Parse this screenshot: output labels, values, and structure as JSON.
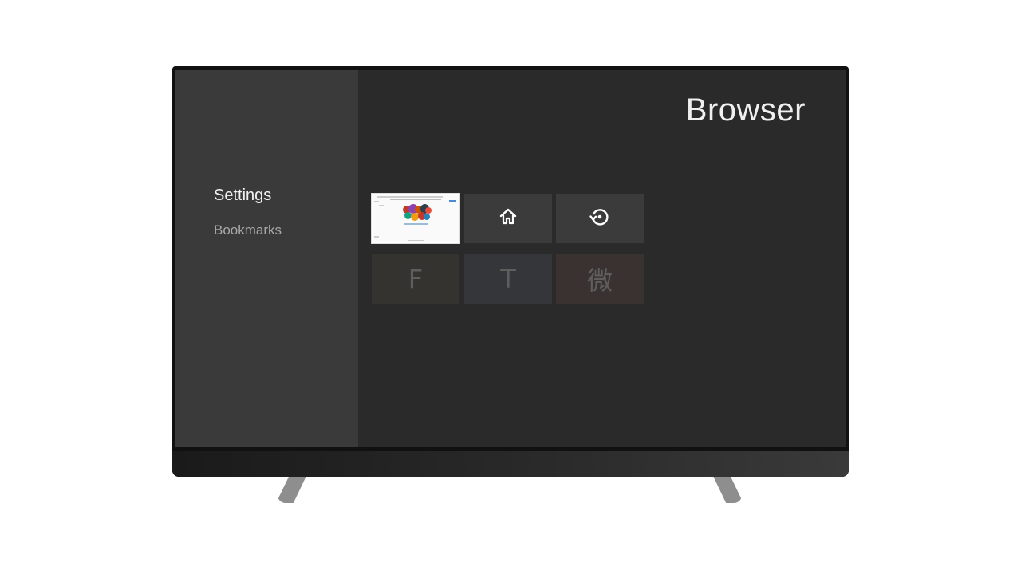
{
  "app": {
    "title": "Browser"
  },
  "sidebar": {
    "items": [
      {
        "label": "Settings",
        "active": true
      },
      {
        "label": "Bookmarks",
        "active": false
      }
    ]
  },
  "tiles": {
    "thumbnail": {
      "kind": "page-preview"
    },
    "home": {
      "icon": "home-icon"
    },
    "history": {
      "icon": "history-icon"
    },
    "shortcuts": [
      {
        "label": "F"
      },
      {
        "label": "T"
      },
      {
        "label": "微"
      }
    ]
  },
  "colors": {
    "screen_bg": "#2a2a2a",
    "sidebar_bg": "#3a3a3a",
    "tile_bg": "#3b3b3b",
    "active_text": "#f2f2f2",
    "inactive_text": "#a8a8a8"
  }
}
